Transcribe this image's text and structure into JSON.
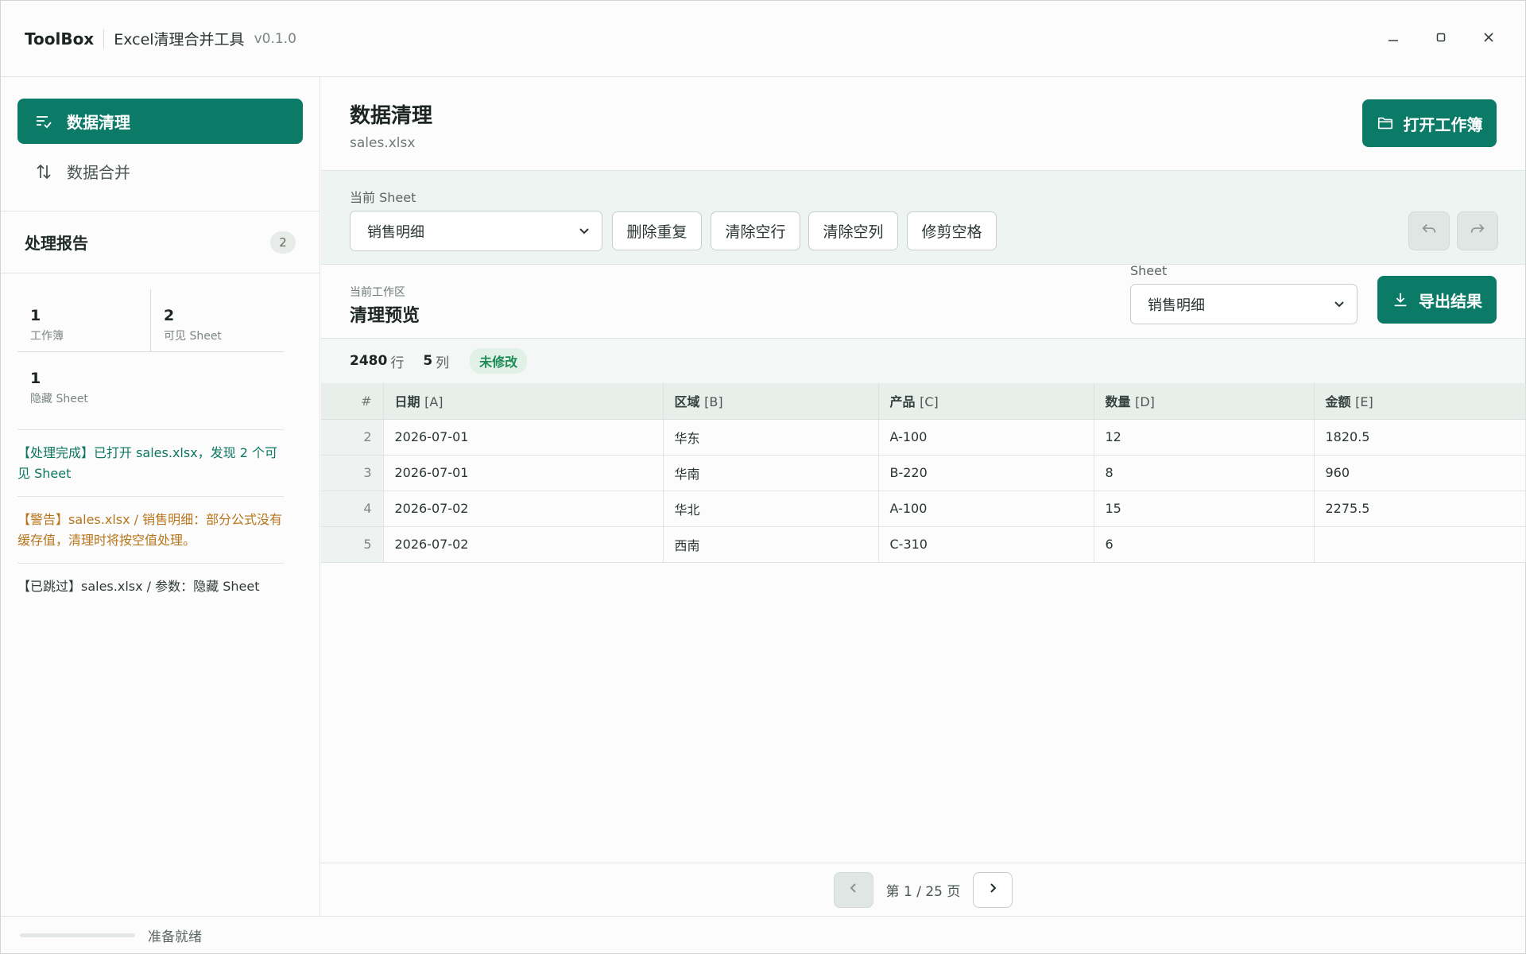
{
  "app": {
    "name": "ToolBox",
    "title": "Excel清理合并工具",
    "version": "v0.1.0"
  },
  "sidebar": {
    "nav": [
      {
        "label": "数据清理",
        "icon": "list-check-icon",
        "active": true
      },
      {
        "label": "数据合并",
        "icon": "sort-arrows-icon",
        "active": false
      }
    ],
    "report": {
      "title": "处理报告",
      "count": "2",
      "stats": [
        {
          "value": "1",
          "label": "工作簿"
        },
        {
          "value": "2",
          "label": "可见 Sheet"
        },
        {
          "value": "1",
          "label": "隐藏 Sheet"
        }
      ],
      "logs": [
        {
          "type": "ok",
          "text": "【处理完成】已打开 sales.xlsx，发现 2 个可见 Sheet"
        },
        {
          "type": "warn",
          "text": "【警告】sales.xlsx / 销售明细：部分公式没有缓存值，清理时将按空值处理。"
        },
        {
          "type": "skip",
          "text": "【已跳过】sales.xlsx / 参数：隐藏 Sheet"
        }
      ]
    }
  },
  "main": {
    "title": "数据清理",
    "file": "sales.xlsx",
    "open_button": "打开工作簿",
    "toolbar": {
      "sheet_label": "当前 Sheet",
      "sheet_value": "销售明细",
      "buttons": [
        "删除重复",
        "清除空行",
        "清除空列",
        "修剪空格"
      ]
    },
    "preview": {
      "subtitle": "当前工作区",
      "title": "清理预览",
      "sheet_label": "Sheet",
      "sheet_value": "销售明细",
      "export_button": "导出结果"
    },
    "summary": {
      "rows": "2480",
      "rows_unit": "行",
      "cols": "5",
      "cols_unit": "列",
      "status": "未修改"
    },
    "table": {
      "index_header": "#",
      "headers": [
        {
          "name": "日期",
          "col": "[A]"
        },
        {
          "name": "区域",
          "col": "[B]"
        },
        {
          "name": "产品",
          "col": "[C]"
        },
        {
          "name": "数量",
          "col": "[D]"
        },
        {
          "name": "金额",
          "col": "[E]"
        }
      ],
      "rows": [
        {
          "idx": "2",
          "cells": [
            "2026-07-01",
            "华东",
            "A-100",
            "12",
            "1820.5"
          ]
        },
        {
          "idx": "3",
          "cells": [
            "2026-07-01",
            "华南",
            "B-220",
            "8",
            "960"
          ]
        },
        {
          "idx": "4",
          "cells": [
            "2026-07-02",
            "华北",
            "A-100",
            "15",
            "2275.5"
          ]
        },
        {
          "idx": "5",
          "cells": [
            "2026-07-02",
            "西南",
            "C-310",
            "6",
            ""
          ]
        }
      ]
    },
    "pager": {
      "text": "第 1 / 25 页"
    }
  },
  "status": {
    "text": "准备就绪",
    "progress": 0
  },
  "colors": {
    "accent": "#0b7a67",
    "warn": "#b8751c",
    "ok": "#0c7660"
  }
}
